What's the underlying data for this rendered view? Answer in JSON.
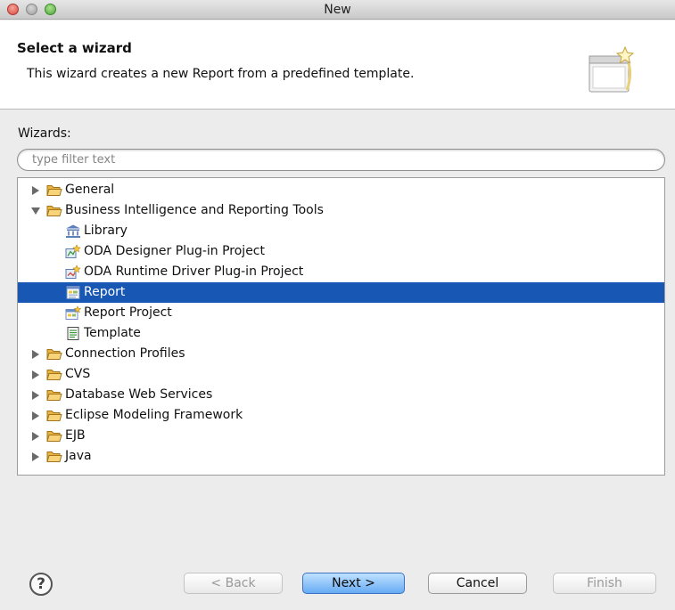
{
  "window": {
    "title": "New"
  },
  "banner": {
    "title": "Select a wizard",
    "description": "This wizard creates a new Report from a predefined template."
  },
  "wizards_label": "Wizards:",
  "filter": {
    "placeholder": "type filter text",
    "value": ""
  },
  "tree": [
    {
      "label": "General",
      "icon": "folder-icon",
      "expander": "collapsed"
    },
    {
      "label": "Business Intelligence and Reporting Tools",
      "icon": "folder-icon",
      "expander": "expanded"
    },
    {
      "label": "Library",
      "icon": "library-icon"
    },
    {
      "label": "ODA Designer Plug-in Project",
      "icon": "plugin-project-icon"
    },
    {
      "label": "ODA Runtime Driver Plug-in Project",
      "icon": "plugin-project-icon"
    },
    {
      "label": "Report",
      "icon": "report-icon",
      "selected": true
    },
    {
      "label": "Report Project",
      "icon": "report-project-icon"
    },
    {
      "label": "Template",
      "icon": "template-icon"
    },
    {
      "label": "Connection Profiles",
      "icon": "folder-icon",
      "expander": "collapsed"
    },
    {
      "label": "CVS",
      "icon": "folder-icon",
      "expander": "collapsed"
    },
    {
      "label": "Database Web Services",
      "icon": "folder-icon",
      "expander": "collapsed"
    },
    {
      "label": "Eclipse Modeling Framework",
      "icon": "folder-icon",
      "expander": "collapsed"
    },
    {
      "label": "EJB",
      "icon": "folder-icon",
      "expander": "collapsed"
    },
    {
      "label": "Java",
      "icon": "folder-icon",
      "expander": "collapsed"
    }
  ],
  "buttons": {
    "help": "?",
    "back": "< Back",
    "next": "Next >",
    "cancel": "Cancel",
    "finish": "Finish"
  },
  "colors": {
    "selection": "#1857b4",
    "default_button": "#67abf4"
  }
}
